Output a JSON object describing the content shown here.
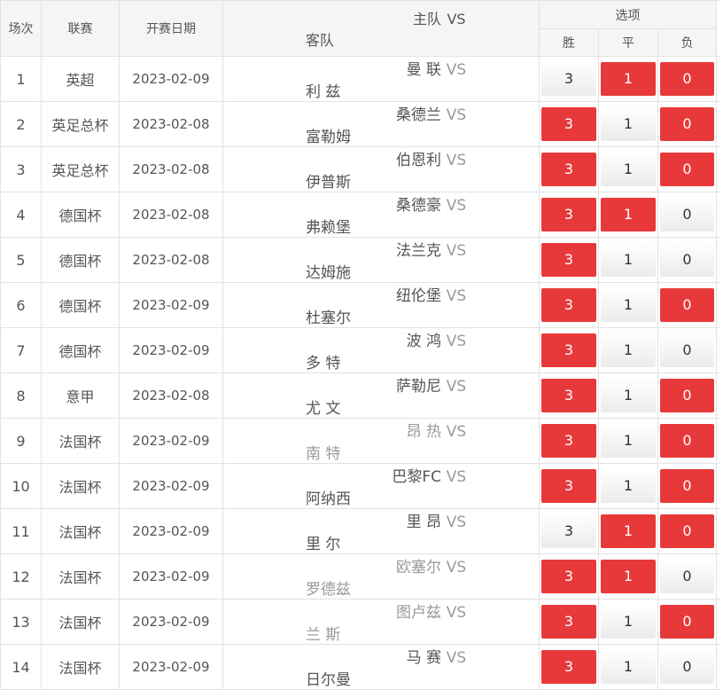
{
  "header": {
    "col_no": "场次",
    "col_league": "联赛",
    "col_date": "开赛日期",
    "col_home": "主队",
    "col_vs": "VS",
    "col_away": "客队",
    "col_options": "选项",
    "opt_win": "胜",
    "opt_draw": "平",
    "opt_lose": "负"
  },
  "colors": {
    "selected": "#e8393a",
    "unselected": "#f2f2f2"
  },
  "matches": [
    {
      "no": "1",
      "league": "英超",
      "date": "2023-02-09",
      "home": "曼 联",
      "vs": "VS",
      "away": "利 兹",
      "muted": false,
      "w": "3",
      "d": "1",
      "l": "0",
      "ws": false,
      "ds": true,
      "ls": true
    },
    {
      "no": "2",
      "league": "英足总杯",
      "date": "2023-02-08",
      "home": "桑德兰",
      "vs": "VS",
      "away": "富勒姆",
      "muted": false,
      "w": "3",
      "d": "1",
      "l": "0",
      "ws": true,
      "ds": false,
      "ls": true
    },
    {
      "no": "3",
      "league": "英足总杯",
      "date": "2023-02-08",
      "home": "伯恩利",
      "vs": "VS",
      "away": "伊普斯",
      "muted": false,
      "w": "3",
      "d": "1",
      "l": "0",
      "ws": true,
      "ds": false,
      "ls": true
    },
    {
      "no": "4",
      "league": "德国杯",
      "date": "2023-02-08",
      "home": "桑德豪",
      "vs": "VS",
      "away": "弗赖堡",
      "muted": false,
      "w": "3",
      "d": "1",
      "l": "0",
      "ws": true,
      "ds": true,
      "ls": false
    },
    {
      "no": "5",
      "league": "德国杯",
      "date": "2023-02-08",
      "home": "法兰克",
      "vs": "VS",
      "away": "达姆施",
      "muted": false,
      "w": "3",
      "d": "1",
      "l": "0",
      "ws": true,
      "ds": false,
      "ls": false
    },
    {
      "no": "6",
      "league": "德国杯",
      "date": "2023-02-09",
      "home": "纽伦堡",
      "vs": "VS",
      "away": "杜塞尔",
      "muted": false,
      "w": "3",
      "d": "1",
      "l": "0",
      "ws": true,
      "ds": false,
      "ls": true
    },
    {
      "no": "7",
      "league": "德国杯",
      "date": "2023-02-09",
      "home": "波 鸿",
      "vs": "VS",
      "away": "多 特",
      "muted": false,
      "w": "3",
      "d": "1",
      "l": "0",
      "ws": true,
      "ds": false,
      "ls": false
    },
    {
      "no": "8",
      "league": "意甲",
      "date": "2023-02-08",
      "home": "萨勒尼",
      "vs": "VS",
      "away": "尤 文",
      "muted": false,
      "w": "3",
      "d": "1",
      "l": "0",
      "ws": true,
      "ds": false,
      "ls": true
    },
    {
      "no": "9",
      "league": "法国杯",
      "date": "2023-02-09",
      "home": "昂 热",
      "vs": "VS",
      "away": "南 特",
      "muted": true,
      "w": "3",
      "d": "1",
      "l": "0",
      "ws": true,
      "ds": false,
      "ls": true
    },
    {
      "no": "10",
      "league": "法国杯",
      "date": "2023-02-09",
      "home": "巴黎FC",
      "vs": "VS",
      "away": "阿纳西",
      "muted": false,
      "w": "3",
      "d": "1",
      "l": "0",
      "ws": true,
      "ds": false,
      "ls": true
    },
    {
      "no": "11",
      "league": "法国杯",
      "date": "2023-02-09",
      "home": "里 昂",
      "vs": "VS",
      "away": "里 尔",
      "muted": false,
      "w": "3",
      "d": "1",
      "l": "0",
      "ws": false,
      "ds": true,
      "ls": true
    },
    {
      "no": "12",
      "league": "法国杯",
      "date": "2023-02-09",
      "home": "欧塞尔",
      "vs": "VS",
      "away": "罗德兹",
      "muted": true,
      "w": "3",
      "d": "1",
      "l": "0",
      "ws": true,
      "ds": true,
      "ls": false
    },
    {
      "no": "13",
      "league": "法国杯",
      "date": "2023-02-09",
      "home": "图卢兹",
      "vs": "VS",
      "away": "兰 斯",
      "muted": true,
      "w": "3",
      "d": "1",
      "l": "0",
      "ws": true,
      "ds": false,
      "ls": true
    },
    {
      "no": "14",
      "league": "法国杯",
      "date": "2023-02-09",
      "home": "马 赛",
      "vs": "VS",
      "away": "日尔曼",
      "muted": false,
      "w": "3",
      "d": "1",
      "l": "0",
      "ws": true,
      "ds": false,
      "ls": false
    }
  ]
}
